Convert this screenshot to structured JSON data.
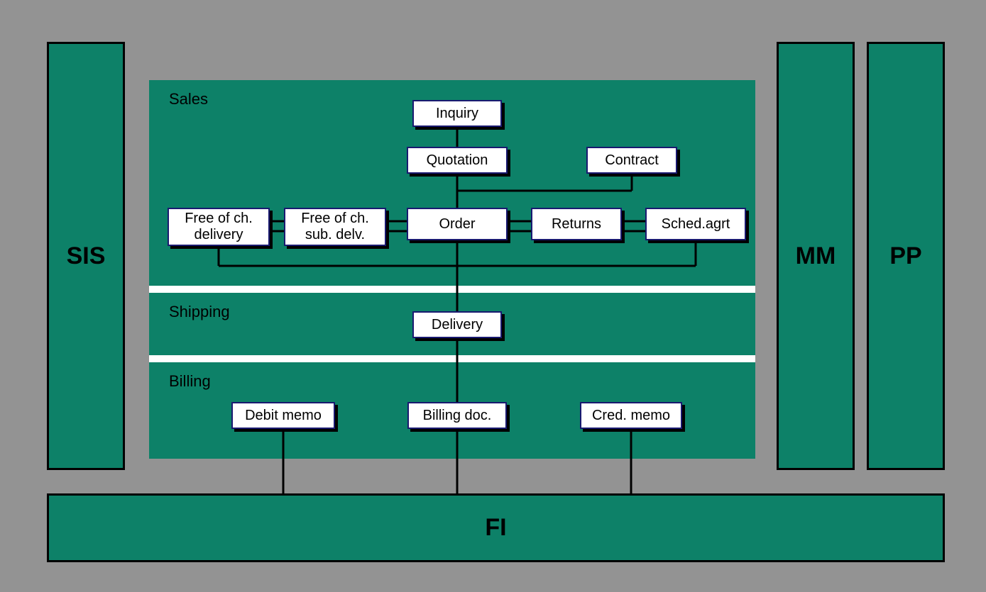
{
  "modules": {
    "sis": "SIS",
    "mm": "MM",
    "pp": "PP",
    "fi": "FI"
  },
  "sections": {
    "sales_label": "Sales",
    "shipping_label": "Shipping",
    "billing_label": "Billing"
  },
  "nodes": {
    "inquiry": "Inquiry",
    "quotation": "Quotation",
    "contract": "Contract",
    "free_delivery": "Free of ch.\ndelivery",
    "free_sub_delv": "Free of ch.\nsub. delv.",
    "order": "Order",
    "returns": "Returns",
    "sched_agrt": "Sched.agrt",
    "delivery": "Delivery",
    "debit_memo": "Debit memo",
    "billing_doc": "Billing doc.",
    "cred_memo": "Cred. memo"
  }
}
